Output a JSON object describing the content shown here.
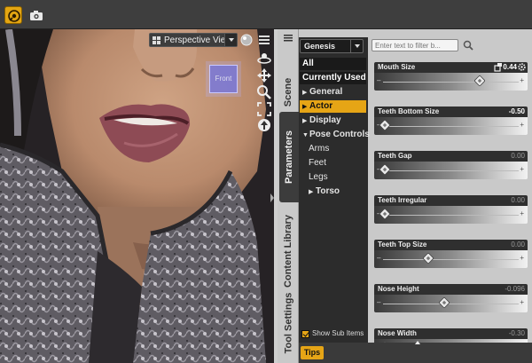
{
  "viewport": {
    "view_name": "Perspective View",
    "cube_label": "Front"
  },
  "tabs": [
    {
      "label": "Scene"
    },
    {
      "label": "Parameters",
      "active": true
    },
    {
      "label": "Content Library"
    },
    {
      "label": "Tool Settings"
    }
  ],
  "tree": {
    "figure": "Genesis",
    "items": [
      {
        "label": "All",
        "style": "hdr"
      },
      {
        "label": "Currently Used",
        "style": "hdr"
      },
      {
        "label": "General",
        "arrow": "right",
        "style": "bold"
      },
      {
        "label": "Actor",
        "arrow": "right",
        "style": "sel"
      },
      {
        "label": "Display",
        "arrow": "right",
        "style": "bold"
      },
      {
        "label": "Pose Controls",
        "arrow": "down",
        "style": "bold"
      },
      {
        "label": "Arms",
        "indent": true
      },
      {
        "label": "Feet",
        "indent": true
      },
      {
        "label": "Legs",
        "indent": true
      },
      {
        "label": "Torso",
        "arrow": "right",
        "style": "bold",
        "indent": true
      }
    ],
    "show_sub_items": "Show Sub Items",
    "show_sub_items_checked": true
  },
  "filter": {
    "placeholder": "Enter text to filter b..."
  },
  "sliders": [
    {
      "name": "Mouth Size",
      "value": "0.44",
      "fraction": 0.72,
      "modified": true
    },
    {
      "name": "Teeth Bottom Size",
      "value": "-0.50",
      "fraction": 0.0,
      "modified": true
    },
    {
      "name": "Teeth Gap",
      "value": "0.00",
      "fraction": 0.0,
      "modified": false
    },
    {
      "name": "Teeth Irregular",
      "value": "0.00",
      "fraction": 0.0,
      "modified": false
    },
    {
      "name": "Teeth Top Size",
      "value": "0.00",
      "fraction": 0.33,
      "modified": false
    },
    {
      "name": "Nose Height",
      "value": "-0.096",
      "fraction": 0.45,
      "modified": false
    },
    {
      "name": "Nose Width",
      "value": "-0.30",
      "fraction": 0.0,
      "modified": false
    }
  ],
  "footer": {
    "tips_label": "Tips"
  },
  "colors": {
    "accent": "#e6a516",
    "panel_dark": "#2c2c2c",
    "panel_light": "#c9c9c9"
  }
}
